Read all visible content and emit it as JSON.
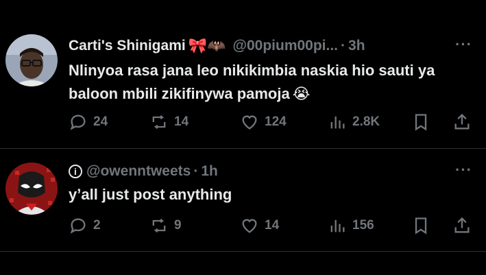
{
  "tweets": [
    {
      "name": "Carti's Shinigami",
      "name_emoji": "🎀🦇",
      "handle": "@00pium00pi...",
      "time": "3h",
      "more": "···",
      "text": "Nlinyoa rasa jana leo nikikimbia naskia hio sauti ya baloon mbili zikifinywa pamoja",
      "text_emoji": "😭",
      "replies": "24",
      "reposts": "14",
      "likes": "124",
      "views": "2.8K"
    },
    {
      "handle": "@owenntweets",
      "time": "1h",
      "info_glyph": "i",
      "more": "···",
      "text": "y’all just post anything",
      "replies": "2",
      "reposts": "9",
      "likes": "14",
      "views": "156"
    }
  ],
  "icons": {
    "reply": "reply-icon",
    "repost": "repost-icon",
    "like": "heart-icon",
    "views": "views-icon",
    "bookmark": "bookmark-icon",
    "share": "share-icon"
  }
}
